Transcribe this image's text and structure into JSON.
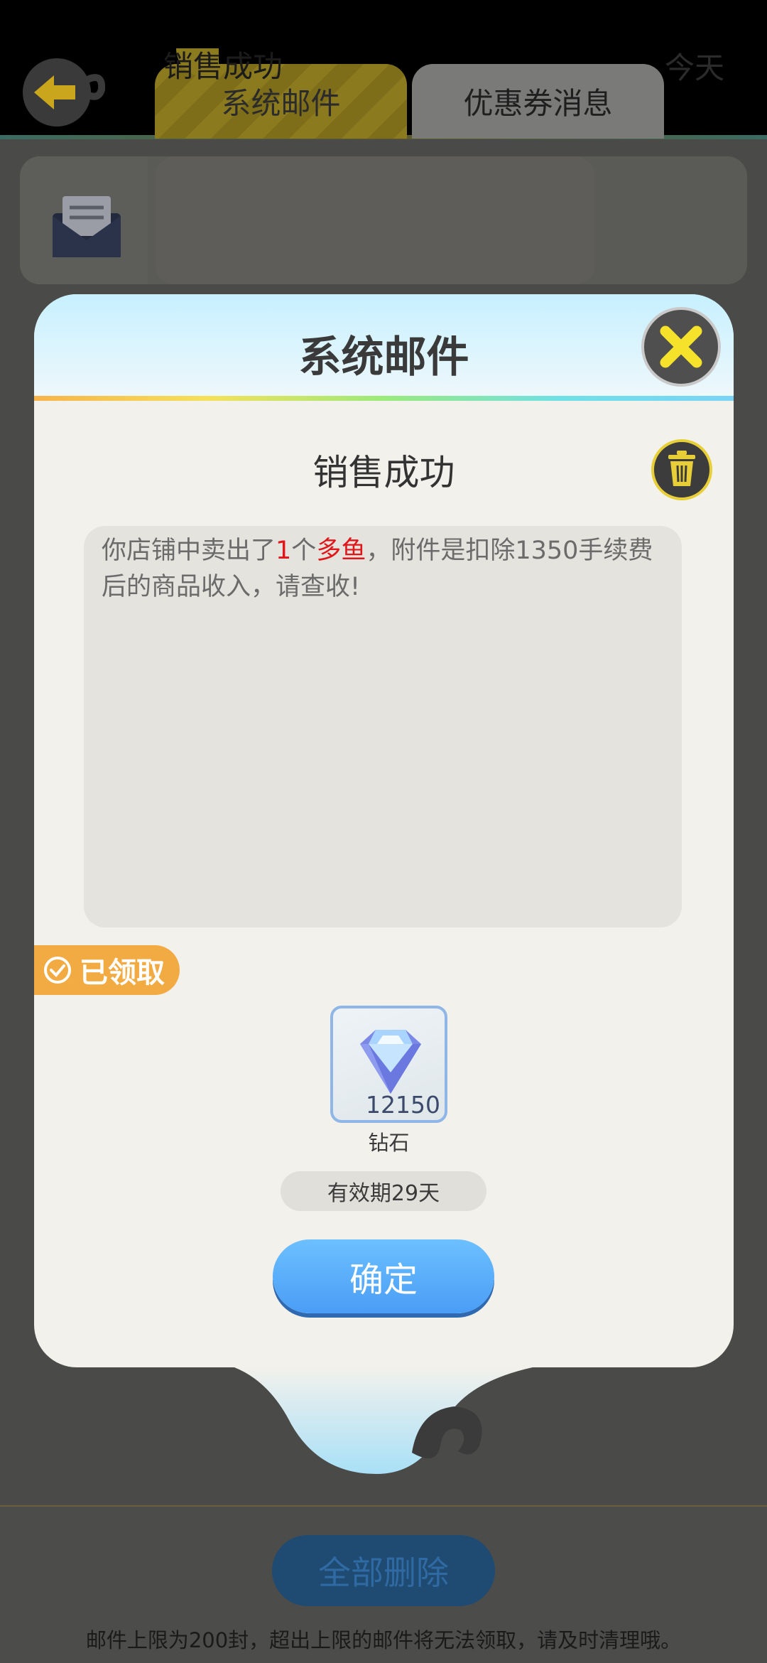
{
  "header": {
    "tabs": [
      {
        "label": "系统邮件",
        "active": true
      },
      {
        "label": "优惠券消息",
        "active": false
      }
    ]
  },
  "mail_list": [
    {
      "title": "销售成功",
      "date": "今天",
      "icon": "envelope-icon"
    }
  ],
  "bottom": {
    "delete_all_label": "全部删除",
    "note": "邮件上限为200封，超出上限的邮件将无法领取，请及时清理哦。"
  },
  "dialog": {
    "title": "系统邮件",
    "subject": "销售成功",
    "message": {
      "part1": "你店铺中卖出了",
      "count": "1",
      "part2": "个",
      "item": "多鱼",
      "part3": "，附件是扣除1350手续费后的商品收入，请查收!"
    },
    "claimed_label": "已领取",
    "attachment": {
      "name": "钻石",
      "count": "12150",
      "icon": "diamond-icon"
    },
    "expiry": "有效期29天",
    "confirm_label": "确定"
  },
  "colors": {
    "accent_blue": "#4a9df5",
    "claimed_orange": "#f2ab42",
    "highlight_red": "#e0161b",
    "trash_border": "#e8cf38"
  }
}
